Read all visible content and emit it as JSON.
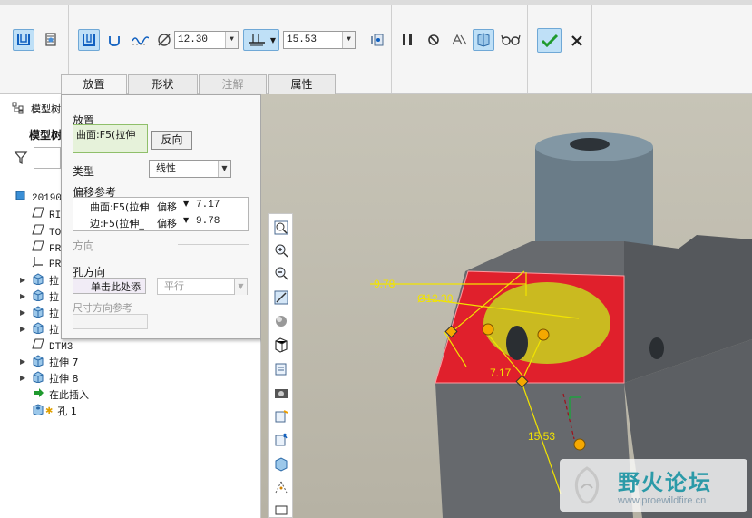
{
  "ribbon": {
    "diameter_value": "12.30",
    "depth_value": "15.53",
    "tools": [
      "simple-hole-icon",
      "standard-hole-icon",
      "straight-hole-icon",
      "countersink-icon",
      "sketch-profile-icon",
      "diameter-icon",
      "depth-type-icon",
      "hole-note-icon",
      "pause-icon",
      "no-preview-icon",
      "verify-icon",
      "geometry-preview-icon",
      "glasses-icon",
      "ok-icon",
      "cancel-icon"
    ]
  },
  "tabs": [
    {
      "label": "放置",
      "active": true
    },
    {
      "label": "形状",
      "active": false
    },
    {
      "label": "注解",
      "active": false,
      "disabled": true
    },
    {
      "label": "属性",
      "active": false
    }
  ],
  "tree": {
    "header": "模型树",
    "subheader": "模型树",
    "items": [
      {
        "label": "20190",
        "icon": "part-icon"
      },
      {
        "label": "RI",
        "icon": "datum-plane-icon"
      },
      {
        "label": "TO",
        "icon": "datum-plane-icon"
      },
      {
        "label": "FR",
        "icon": "datum-plane-icon"
      },
      {
        "label": "PR",
        "icon": "coordinate-system-icon"
      },
      {
        "label": "拉",
        "icon": "extrude-icon"
      },
      {
        "label": "拉",
        "icon": "extrude-icon"
      },
      {
        "label": "拉",
        "icon": "extrude-icon"
      },
      {
        "label": "拉",
        "icon": "extrude-icon"
      },
      {
        "label": "DTM3",
        "icon": "datum-plane-icon"
      },
      {
        "label": "拉伸 7",
        "icon": "extrude-icon"
      },
      {
        "label": "拉伸 8",
        "icon": "extrude-icon"
      },
      {
        "label": "在此插入",
        "icon": "insert-arrow-icon"
      },
      {
        "label": "孔 1",
        "icon": "hole-icon"
      }
    ]
  },
  "placement": {
    "section_title": "放置",
    "primary_ref": "曲面:F5(拉伸",
    "flip_button": "反向",
    "type_label": "类型",
    "type_value": "线性",
    "offset_refs_label": "偏移参考",
    "offset_refs": [
      {
        "ref": "曲面:F5(拉伸",
        "mode": "偏移",
        "value": "7.17"
      },
      {
        "ref": "边:F5(拉伸_",
        "mode": "偏移",
        "value": "9.78"
      }
    ],
    "direction_label": "方向",
    "hole_direction_label": "孔方向",
    "hole_direction_placeholder": "单击此处添",
    "hole_direction_mode": "平行",
    "dim_direction_label": "尺寸方向参考"
  },
  "viewport": {
    "dims": {
      "offset1": "9.78",
      "diameter": "Ø12.30",
      "offset2": "7.17",
      "depth": "15.53"
    }
  },
  "watermark": {
    "brand": "野火论坛",
    "url": "www.proewildfire.cn"
  },
  "colors": {
    "selected_surface": "#e0202c",
    "hole_preview": "#c8c820",
    "dimension": "#f2e400",
    "handle": "#f5a800",
    "body": "#6c6e72"
  }
}
